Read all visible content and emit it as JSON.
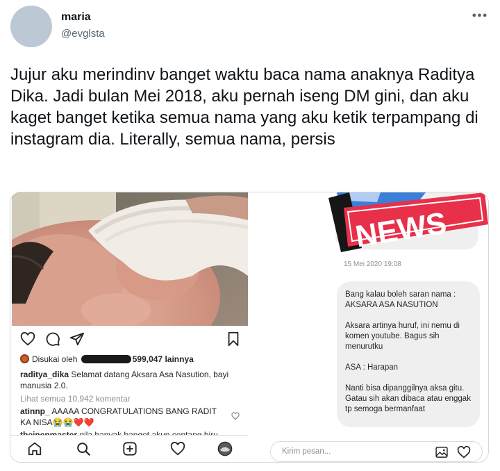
{
  "author": {
    "name": "maria",
    "handle": "@evglsta",
    "more_icon": "ellipsis-icon"
  },
  "tweet": {
    "text": "Jujur aku merindinv banget waktu baca nama anaknya Raditya Dika. Jadi bulan Mei 2018, aku pernah iseng DM gini, dan aku kaget banget ketika semua nama yang aku ketik terpampang di instagram dia. Literally, semua nama, persis"
  },
  "instagram_post": {
    "liked_prefix": "Disukai oleh",
    "liked_count": "599,047",
    "liked_suffix": "lainnya",
    "caption_user": "raditya_dika",
    "caption_text": "Selamat datang Aksara Asa Nasution, bayi manusia 2.0.",
    "view_all_comments": "Lihat semua 10,942 komentar",
    "comment1_user": "atinnp_",
    "comment1_text": "AAAAA CONGRATULATIONS BANG RADIT KA NISA😭😭❤️❤️",
    "comment2_user": "theinenmaster",
    "comment2_text": "gila banyak banget akun centang biru",
    "action_icons": [
      "heart-outline-icon",
      "comment-icon",
      "send-icon",
      "bookmark-icon"
    ],
    "nav_icons": [
      "home-icon",
      "search-icon",
      "add-post-icon",
      "activity-heart-icon",
      "profile-avatar-icon"
    ]
  },
  "dm": {
    "sticker_text": "NEWS",
    "timestamp": "15 Mei 2020 19:08",
    "message_lines": [
      "Bang kalau boleh saran nama : AKSARA ASA NASUTION",
      "Aksara artinya huruf, ini nemu di komen youtube. Bagus sih menurutku",
      "ASA : Harapan",
      "Nanti bisa dipanggilnya aksa gitu. Gatau sih akan dibaca atau enggak tp semoga bermanfaat"
    ],
    "input_placeholder": "Kirim pesan...",
    "input_icons": [
      "image-icon",
      "heart-icon"
    ]
  },
  "colors": {
    "text_primary": "#0f1419",
    "text_secondary": "#536471",
    "border": "#cfd9de",
    "bubble": "#efefef",
    "news_red": "#e8304a",
    "news_blue": "#3b7fd9"
  }
}
